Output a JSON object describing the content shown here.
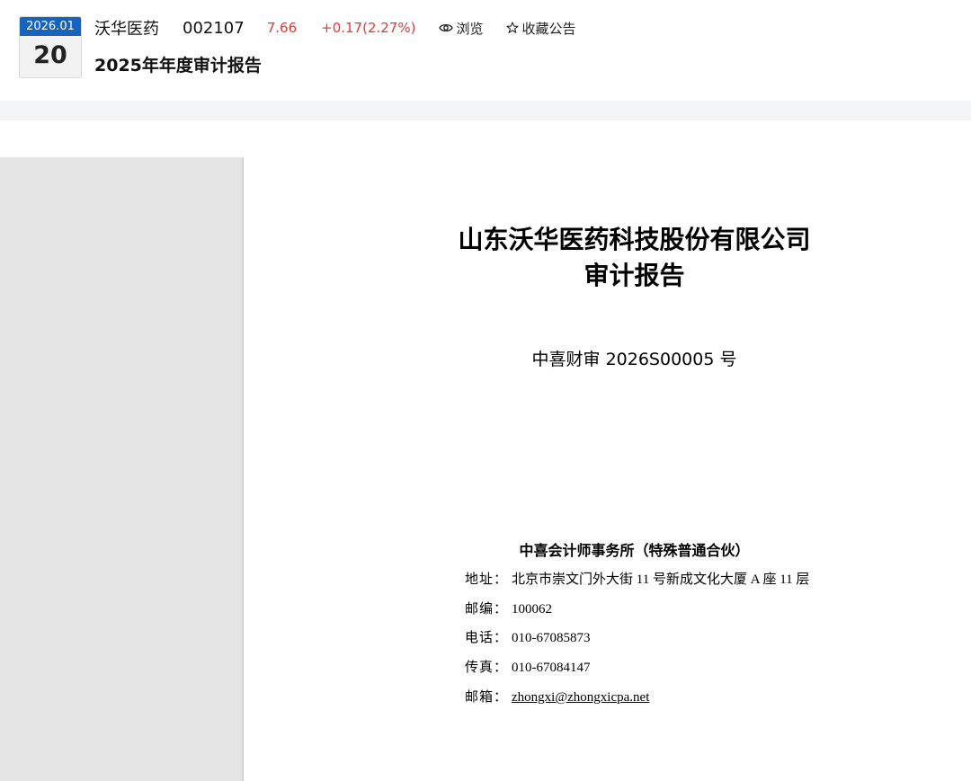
{
  "header": {
    "date": {
      "year_month": "2026.01",
      "day": "20"
    },
    "stock": {
      "name": "沃华医药",
      "code": "002107",
      "price": "7.66",
      "change": "+0.17(2.27%)"
    },
    "actions": {
      "browse_label": "浏览",
      "favorite_label": "收藏公告",
      "browse_icon": "eye-icon",
      "favorite_icon": "star-outline-icon"
    },
    "notice_title": "2025年年度审计报告"
  },
  "document": {
    "company": "山东沃华医药科技股份有限公司",
    "report_type": "审计报告",
    "report_number": "中喜财审 2026S00005 号",
    "firm": "中喜会计师事务所（特殊普通合伙）",
    "contacts": {
      "address_label": "地址：",
      "address": "北京市崇文门外大街 11 号新成文化大厦 A 座 11 层",
      "postcode_label": "邮编：",
      "postcode": "100062",
      "phone_label": "电话：",
      "phone": "010-67085873",
      "fax_label": "传真：",
      "fax": "010-67084147",
      "email_label": "邮箱：",
      "email": "zhongxi@zhongxicpa.net"
    }
  },
  "colors": {
    "date_badge_blue": "#1565c0",
    "price_up_red": "#e53935",
    "side_panel_gray": "#e4e4e4"
  }
}
